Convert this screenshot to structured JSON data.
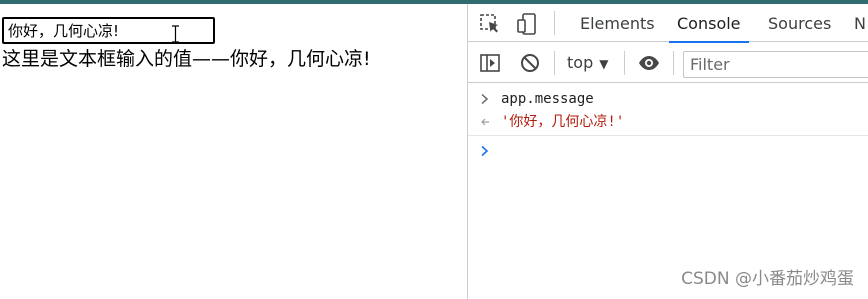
{
  "page": {
    "input_value": "你好，几何心凉!",
    "output_text": "这里是文本框输入的值——你好，几何心凉!"
  },
  "devtools": {
    "tabs": [
      {
        "label": "Elements",
        "active": false
      },
      {
        "label": "Console",
        "active": true
      },
      {
        "label": "Sources",
        "active": false
      },
      {
        "label": "N",
        "active": false
      }
    ],
    "context": "top",
    "filter_placeholder": "Filter"
  },
  "console": {
    "entries": [
      {
        "kind": "command",
        "text": "app.message"
      },
      {
        "kind": "result",
        "text": "'你好，几何心凉!'"
      }
    ]
  },
  "watermark": "CSDN @小番茄炒鸡蛋",
  "colors": {
    "accent": "#1a73e8",
    "result_string": "#b21d0c",
    "prompt_blue": "#1a73e8",
    "topbar": "#2f6b6f"
  },
  "icons": [
    "inspect-element-icon",
    "device-toggle-icon",
    "sidebar-toggle-icon",
    "clear-console-icon",
    "eye-icon",
    "chevron-right-icon",
    "return-arrow-icon",
    "prompt-chevron-icon"
  ]
}
